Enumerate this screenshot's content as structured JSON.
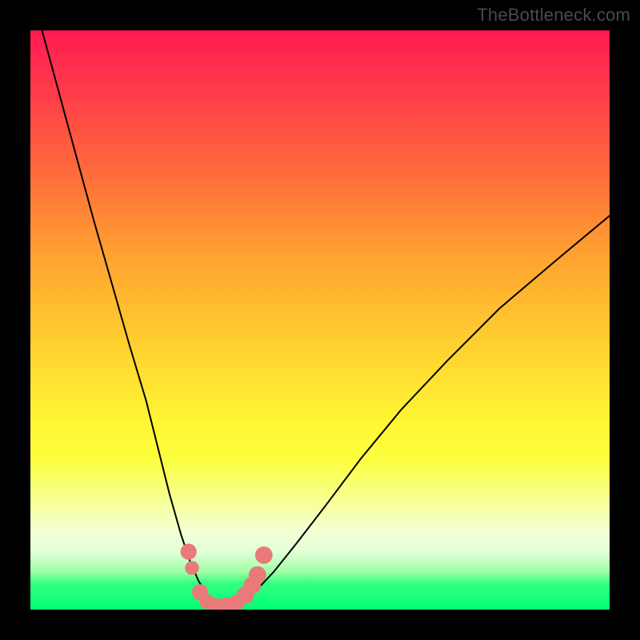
{
  "watermark": "TheBottleneck.com",
  "chart_data": {
    "type": "line",
    "title": "",
    "xlabel": "",
    "ylabel": "",
    "xlim": [
      0,
      100
    ],
    "ylim": [
      0,
      100
    ],
    "series": [
      {
        "name": "bottleneck-curve",
        "x": [
          2,
          5,
          8,
          11,
          14,
          17,
          20,
          22,
          24,
          26,
          27.5,
          29,
          30.5,
          32,
          34,
          36,
          38.5,
          42,
          46,
          51,
          57,
          64,
          72,
          81,
          91,
          100
        ],
        "y": [
          100,
          89,
          78,
          67,
          56.5,
          46,
          36,
          28,
          20,
          13,
          8.5,
          5,
          2.5,
          1,
          0.2,
          0.8,
          2.8,
          6.5,
          11.5,
          18,
          26,
          34.5,
          43,
          52,
          60.5,
          68
        ]
      }
    ],
    "markers": {
      "name": "highlight-points",
      "color": "#e97a7a",
      "points": [
        {
          "x": 27.3,
          "y": 10.0,
          "r": 1.4
        },
        {
          "x": 27.9,
          "y": 7.2,
          "r": 1.2
        },
        {
          "x": 29.3,
          "y": 3.0,
          "r": 1.4
        },
        {
          "x": 30.5,
          "y": 1.4,
          "r": 1.3
        },
        {
          "x": 32.2,
          "y": 0.7,
          "r": 1.3
        },
        {
          "x": 33.8,
          "y": 0.7,
          "r": 1.4
        },
        {
          "x": 35.6,
          "y": 1.2,
          "r": 1.4
        },
        {
          "x": 37.1,
          "y": 2.5,
          "r": 1.5
        },
        {
          "x": 38.3,
          "y": 4.2,
          "r": 1.5
        },
        {
          "x": 39.2,
          "y": 6.0,
          "r": 1.5
        },
        {
          "x": 40.3,
          "y": 9.4,
          "r": 1.5
        }
      ]
    }
  }
}
